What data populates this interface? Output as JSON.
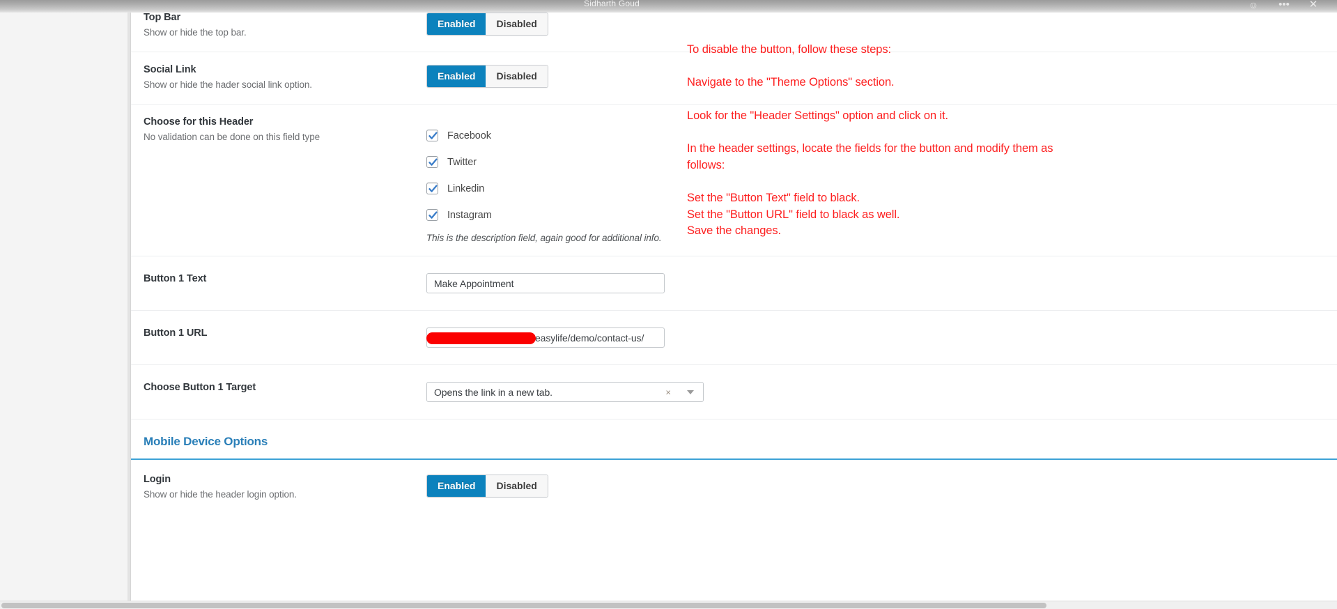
{
  "window": {
    "title": "Sidharth Goud",
    "emoji_icon": "smiley-icon",
    "more_icon": "•••",
    "close_icon": "✕"
  },
  "settings": {
    "rows": [
      {
        "id": "top-bar",
        "title": "Top Bar",
        "subtitle": "Show or hide the top bar.",
        "control": "toggle",
        "enabled_label": "Enabled",
        "disabled_label": "Disabled",
        "selected": "Enabled"
      },
      {
        "id": "social-link",
        "title": "Social Link",
        "subtitle": "Show or hide the hader social link option.",
        "control": "toggle",
        "enabled_label": "Enabled",
        "disabled_label": "Disabled",
        "selected": "Enabled"
      },
      {
        "id": "choose-for-this-header",
        "title": "Choose for this Header",
        "subtitle": "No validation can be done on this field type",
        "control": "checkboxes",
        "options": [
          {
            "label": "Facebook",
            "checked": true
          },
          {
            "label": "Twitter",
            "checked": true
          },
          {
            "label": "Linkedin",
            "checked": true
          },
          {
            "label": "Instagram",
            "checked": true
          }
        ],
        "description": "This is the description field, again good for additional info."
      },
      {
        "id": "button-1-text",
        "title": "Button 1 Text",
        "subtitle": "",
        "control": "text",
        "value": "Make Appointment",
        "placeholder": ""
      },
      {
        "id": "button-1-url",
        "title": "Button 1 URL",
        "subtitle": "",
        "control": "text-redacted",
        "value": "easylife/demo/contact-us/",
        "placeholder": "",
        "redaction_color": "#fb0000"
      },
      {
        "id": "choose-button-1-target",
        "title": "Choose Button 1 Target",
        "subtitle": "",
        "control": "select",
        "value": "Opens the link in a new tab.",
        "clear_icon": "×",
        "arrow_icon": "chevron-down-icon"
      }
    ],
    "section_heading": "Mobile Device Options",
    "mobile_rows": [
      {
        "id": "login",
        "title": "Login",
        "subtitle": "Show or hide the header login option.",
        "control": "toggle",
        "enabled_label": "Enabled",
        "disabled_label": "Disabled",
        "selected": "Enabled"
      }
    ]
  },
  "annotations": {
    "color": "#fd2020",
    "lines": [
      "To disable the button, follow these steps:",
      "Navigate to the \"Theme Options\" section.",
      "Look for the \"Header Settings\" option and click on it.",
      "In the header settings, locate the fields for the button and modify them as follows:",
      "Set the \"Button Text\" field to black.",
      "Set the \"Button URL\" field to black as well.",
      "Save the changes."
    ]
  },
  "theme": {
    "accent_blue": "#0c82bd",
    "heading_blue": "#2a7fb8",
    "annotation_red": "#fd2020",
    "redaction_red": "#fb0000"
  }
}
